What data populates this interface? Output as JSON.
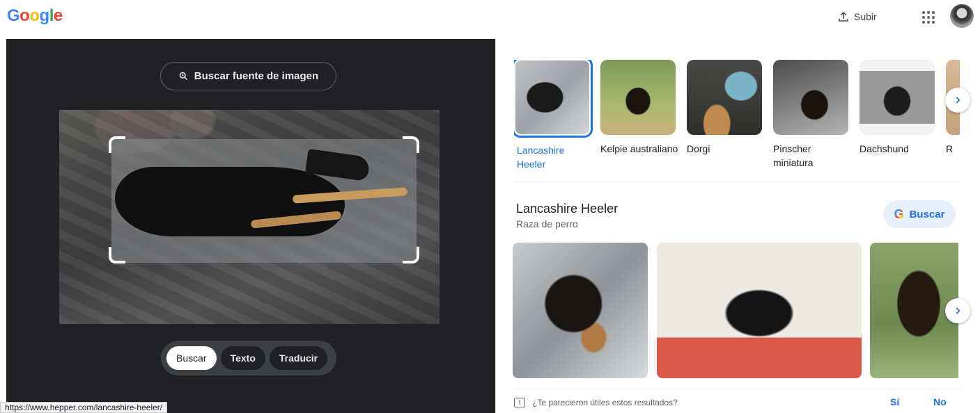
{
  "header": {
    "logo": [
      "G",
      "o",
      "o",
      "g",
      "l",
      "e"
    ],
    "logo_colors": [
      "#4285f4",
      "#ea4335",
      "#fbbc05",
      "#4285f4",
      "#34a853",
      "#ea4335"
    ],
    "upload_label": "Subir"
  },
  "lens": {
    "source_button_label": "Buscar fuente de imagen",
    "modes": [
      "Buscar",
      "Texto",
      "Traducir"
    ],
    "active_mode": "Buscar"
  },
  "status_url": "https://www.hepper.com/lancashire-heeler/",
  "breeds": [
    {
      "label": "Lancashire Heeler",
      "selected": true
    },
    {
      "label": "Kelpie australiano",
      "selected": false
    },
    {
      "label": "Dorgi",
      "selected": false
    },
    {
      "label": "Pinscher miniatura",
      "selected": false
    },
    {
      "label": "Dachshund",
      "selected": false
    },
    {
      "label": "R",
      "selected": false
    }
  ],
  "knowledge_panel": {
    "title": "Lancashire Heeler",
    "subtitle": "Raza de perro",
    "search_button": "Buscar"
  },
  "feedback": {
    "question": "¿Te parecieron útiles estos resultados?",
    "yes": "Sí",
    "no": "No"
  },
  "colors": {
    "accent": "#1a73e8",
    "dark_panel": "#202124"
  }
}
